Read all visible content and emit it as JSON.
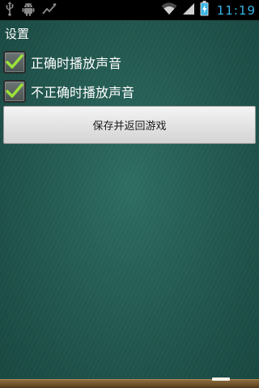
{
  "status_bar": {
    "time": "11:19",
    "icons": [
      "usb-icon",
      "android-debug-icon",
      "activity-icon",
      "wifi-icon",
      "signal-icon",
      "battery-icon"
    ]
  },
  "settings": {
    "title": "设置",
    "options": [
      {
        "label": "正确时播放声音",
        "checked": true
      },
      {
        "label": "不正确时播放声音",
        "checked": true
      }
    ],
    "save_button_label": "保存并返回游戏"
  },
  "colors": {
    "board": "#245b52",
    "checkmark": "#9be23a",
    "time_accent": "#33b5e5",
    "frame": "#6e5028"
  }
}
